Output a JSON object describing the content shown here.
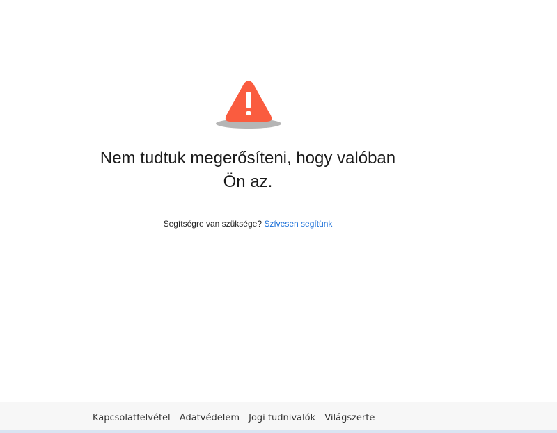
{
  "error": {
    "icon": "warning-triangle-icon",
    "icon_color": "#fa5c3f",
    "shadow_color": "#b5b5b5",
    "headline": "Nem tudtuk megerősíteni, hogy valóban Ön az."
  },
  "help": {
    "prompt": "Segítségre van szüksége?",
    "link_label": "Szívesen segítünk",
    "link_color": "#1a6fd8"
  },
  "footer": {
    "links": [
      "Kapcsolatfelvétel",
      "Adatvédelem",
      "Jogi tudnivalók",
      "Világszerte"
    ]
  }
}
